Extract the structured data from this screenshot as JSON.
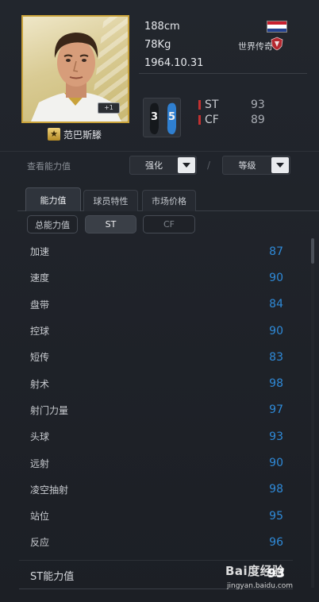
{
  "player": {
    "name": "范巴斯滕",
    "plus_badge": "+1",
    "height": "188cm",
    "weight": "78Kg",
    "birthdate": "1964.10.31",
    "nation": "荷兰",
    "league": "世界传奇"
  },
  "feet": {
    "left": "3",
    "right": "5"
  },
  "positions": [
    {
      "name": "ST",
      "value": "93"
    },
    {
      "name": "CF",
      "value": "89"
    }
  ],
  "enhance": {
    "label": "查看能力值",
    "dropdown1": "强化",
    "separator": "/",
    "dropdown2": "等级"
  },
  "tabs": [
    {
      "label": "能力值"
    },
    {
      "label": "球员特性"
    },
    {
      "label": "市场价格"
    }
  ],
  "subtabs": [
    {
      "label": "总能力值"
    },
    {
      "label": "ST"
    },
    {
      "label": "CF"
    }
  ],
  "stats": [
    {
      "name": "加速",
      "value": "87"
    },
    {
      "name": "速度",
      "value": "90"
    },
    {
      "name": "盘带",
      "value": "84"
    },
    {
      "name": "控球",
      "value": "90"
    },
    {
      "name": "短传",
      "value": "83"
    },
    {
      "name": "射术",
      "value": "98"
    },
    {
      "name": "射门力量",
      "value": "97"
    },
    {
      "name": "头球",
      "value": "93"
    },
    {
      "name": "远射",
      "value": "90"
    },
    {
      "name": "凌空抽射",
      "value": "98"
    },
    {
      "name": "站位",
      "value": "95"
    },
    {
      "name": "反应",
      "value": "96"
    }
  ],
  "summary": {
    "label": "ST能力值",
    "value": "93"
  },
  "watermark": {
    "text": "Bai度经验",
    "url": "jingyan.baidu.com"
  },
  "colors": {
    "accent": "#2f8ad8",
    "position_bar": "#c23131",
    "frame_gold": "#c9a23a"
  }
}
